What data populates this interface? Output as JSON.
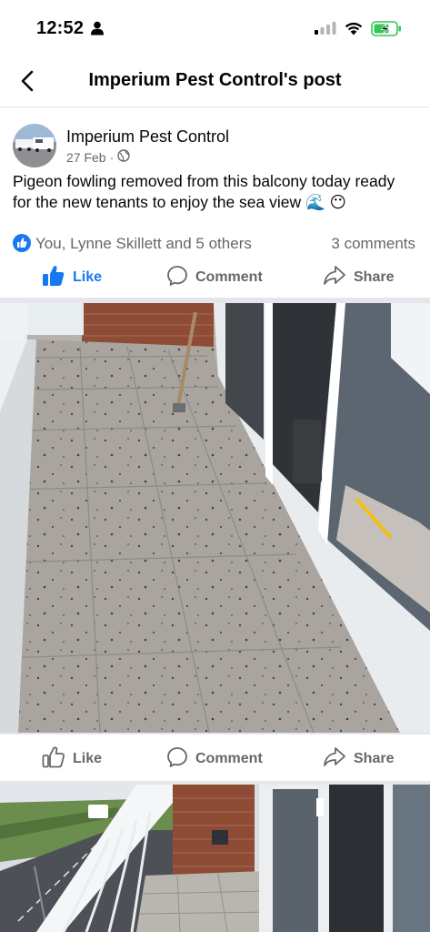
{
  "status_bar": {
    "time": "12:52",
    "icons": [
      "person-icon",
      "signal-icon",
      "wifi-icon",
      "battery-charging-icon"
    ]
  },
  "nav": {
    "title": "Imperium Pest Control's post",
    "back_icon": "back-chevron-icon"
  },
  "post": {
    "author": "Imperium Pest Control",
    "date": "27 Feb",
    "separator": "·",
    "audience_icon": "globe-icon",
    "text": "Pigeon fowling removed from this balcony today ready for the new tenants to enjoy the sea view 🌊 😶",
    "reactions": {
      "icon": "like-reaction-icon",
      "summary": "You, Lynne Skillett and 5 others",
      "comments": "3 comments"
    },
    "actions": {
      "like": "Like",
      "comment": "Comment",
      "share": "Share"
    },
    "photo_actions": {
      "like": "Like",
      "comment": "Comment",
      "share": "Share"
    }
  },
  "colors": {
    "brand_blue": "#1877f2",
    "secondary_text": "#65676b",
    "divider": "#e4e6eb",
    "battery_green": "#34c759"
  }
}
